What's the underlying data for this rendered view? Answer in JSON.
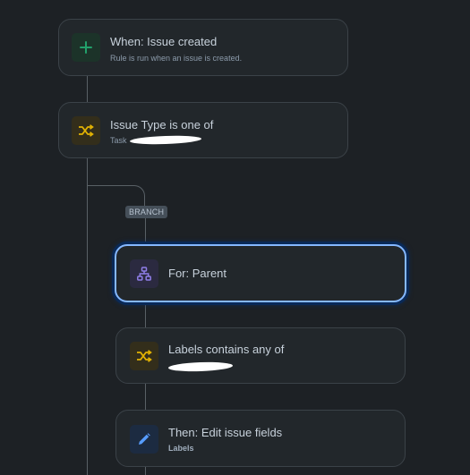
{
  "steps": {
    "trigger": {
      "title": "When: Issue created",
      "subtitle": "Rule is run when an issue is created.",
      "icon": "plus-icon",
      "icon_color": "#22a06b"
    },
    "condition_issue_type": {
      "title": "Issue Type is one of",
      "subtitle": "Task",
      "icon": "shuffle-icon",
      "icon_color": "#e2b203"
    },
    "branch": {
      "badge": "BRANCH"
    },
    "branch_for": {
      "title": "For: Parent",
      "icon": "hierarchy-icon",
      "icon_color": "#8f7ee7"
    },
    "condition_labels": {
      "title": "Labels contains any of",
      "icon": "shuffle-icon",
      "icon_color": "#e2b203"
    },
    "action_edit": {
      "title": "Then: Edit issue fields",
      "subtitle": "Labels",
      "icon": "pencil-icon",
      "icon_color": "#579dff"
    }
  },
  "colors": {
    "background": "#1d2125",
    "card": "#22272b",
    "selected_border": "#85b8ff"
  }
}
